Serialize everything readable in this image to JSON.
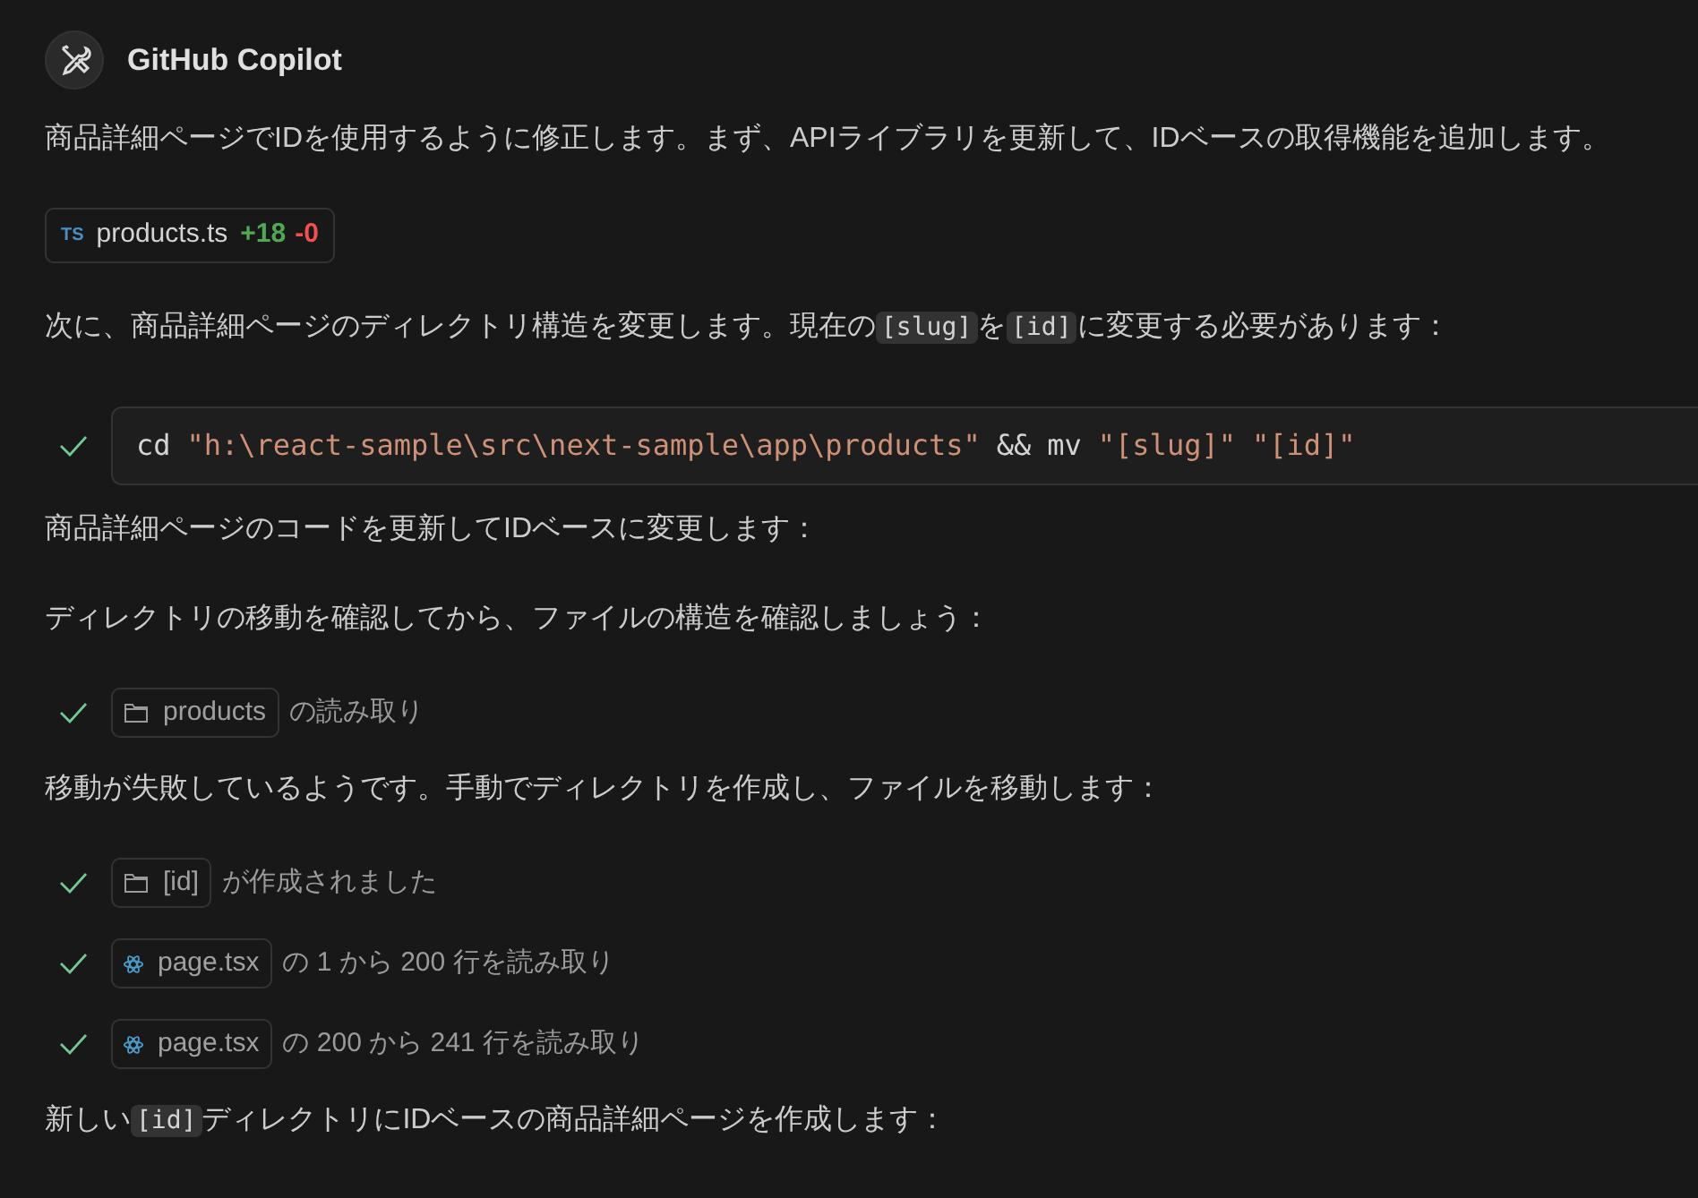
{
  "header": {
    "title": "GitHub Copilot"
  },
  "blocks": [
    {
      "kind": "paragraph",
      "parts": [
        {
          "kind": "text",
          "text": "商品詳細ページでIDを使用するように修正します。まず、APIライブラリを更新して、IDベースの取得機能を追加します。"
        }
      ]
    },
    {
      "kind": "file_chip",
      "badge": "TS",
      "name": "products.ts",
      "added": "+18",
      "removed": "-0"
    },
    {
      "kind": "paragraph",
      "parts": [
        {
          "kind": "text",
          "text": "次に、商品詳細ページのディレクトリ構造を変更します。現在の"
        },
        {
          "kind": "code",
          "text": "[slug]"
        },
        {
          "kind": "text",
          "text": "を"
        },
        {
          "kind": "code",
          "text": "[id]"
        },
        {
          "kind": "text",
          "text": "に変更する必要があります："
        }
      ]
    },
    {
      "kind": "terminal",
      "checked": true,
      "tokens": [
        {
          "kind": "plain",
          "text": "cd"
        },
        {
          "kind": "string",
          "text": "\"h:\\react-sample\\src\\next-sample\\app\\products\""
        },
        {
          "kind": "plain",
          "text": "&&"
        },
        {
          "kind": "plain",
          "text": "mv"
        },
        {
          "kind": "string",
          "text": "\"[slug]\""
        },
        {
          "kind": "string",
          "text": "\"[id]\""
        }
      ]
    },
    {
      "kind": "paragraph",
      "parts": [
        {
          "kind": "text",
          "text": "商品詳細ページのコードを更新してIDベースに変更します："
        }
      ]
    },
    {
      "kind": "paragraph",
      "parts": [
        {
          "kind": "text",
          "text": "ディレクトリの移動を確認してから、ファイルの構造を確認しましょう："
        }
      ]
    },
    {
      "kind": "folder_tool",
      "checked": true,
      "label": "products",
      "text": "の読み取り"
    },
    {
      "kind": "paragraph",
      "parts": [
        {
          "kind": "text",
          "text": "移動が失敗しているようです。手動でディレクトリを作成し、ファイルを移動します："
        }
      ]
    },
    {
      "kind": "folder_tool",
      "checked": true,
      "label": "[id]",
      "text": "が作成されました"
    },
    {
      "kind": "file_tool",
      "checked": true,
      "label": "page.tsx",
      "text": "の 1 から 200 行を読み取り"
    },
    {
      "kind": "file_tool",
      "checked": true,
      "label": "page.tsx",
      "text": "の 200 から 241 行を読み取り"
    },
    {
      "kind": "paragraph",
      "parts": [
        {
          "kind": "text",
          "text": "新しい"
        },
        {
          "kind": "code",
          "text": "[id]"
        },
        {
          "kind": "text",
          "text": "ディレクトリにIDベースの商品詳細ページを作成します："
        }
      ]
    }
  ]
}
